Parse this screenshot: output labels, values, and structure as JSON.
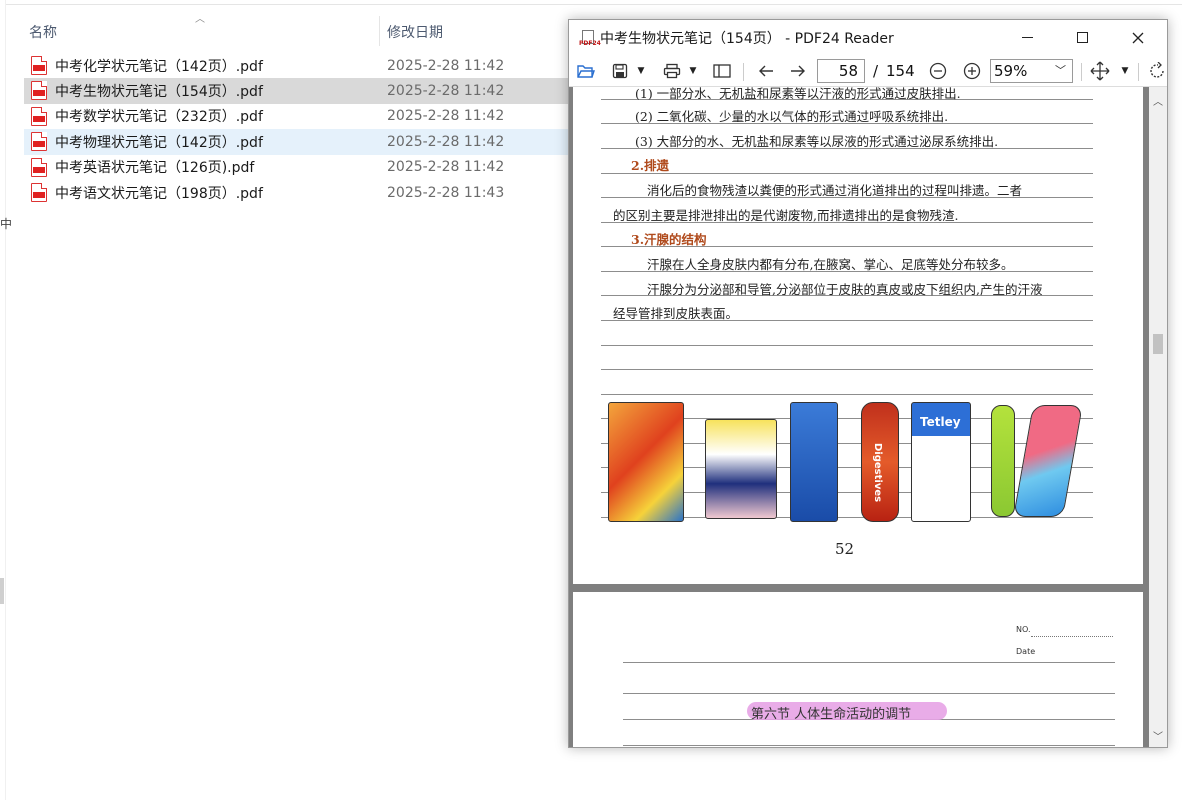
{
  "explorer": {
    "columns": {
      "name": "名称",
      "date": "修改日期"
    },
    "files": [
      {
        "name": "中考化学状元笔记（142页）.pdf",
        "date": "2025-2-28 11:42"
      },
      {
        "name": "中考生物状元笔记（154页）.pdf",
        "date": "2025-2-28 11:42"
      },
      {
        "name": "中考数学状元笔记（232页）.pdf",
        "date": "2025-2-28 11:42"
      },
      {
        "name": "中考物理状元笔记（142页）.pdf",
        "date": "2025-2-28 11:42"
      },
      {
        "name": "中考英语状元笔记（126页).pdf",
        "date": "2025-2-28 11:42"
      },
      {
        "name": "中考语文状元笔记（198页）.pdf",
        "date": "2025-2-28 11:43"
      }
    ],
    "left_edge_char": "中"
  },
  "reader": {
    "title": "中考生物状元笔记（154页）  - PDF24 Reader",
    "app_icon_text": "PDF24",
    "toolbar": {
      "current_page": "58",
      "page_separator": "/",
      "total_pages": "154",
      "zoom": "59%"
    },
    "page1": {
      "lines": [
        "(1) 一部分水、无机盐和尿素等以汗液的形式通过皮肤排出.",
        "(2) 二氧化碳、少量的水以气体的形式通过呼吸系统排出.",
        "(3) 大部分的水、无机盐和尿素等以尿液的形式通过泌尿系统排出.",
        "2.排遗",
        "消化后的食物残渣以粪便的形式通过消化道排出的过程叫排遗。二者",
        "的区别主要是排泄排出的是代谢废物,而排遗排出的是食物残渣.",
        "3.汗腺的结构",
        "汗腺在人全身皮肤内都有分布,在腋窝、掌心、足底等处分布较多。",
        "汗腺分为分泌部和导管,分泌部位于皮肤的真皮或皮下组织内,产生的汗液",
        "经导管排到皮肤表面。"
      ],
      "page_number": "52",
      "snacks": [
        "Digestives",
        "Tetley"
      ]
    },
    "page2": {
      "no_label": "NO.",
      "date_label": "Date",
      "chapter_title": "第六节  人体生命活动的调节"
    }
  }
}
